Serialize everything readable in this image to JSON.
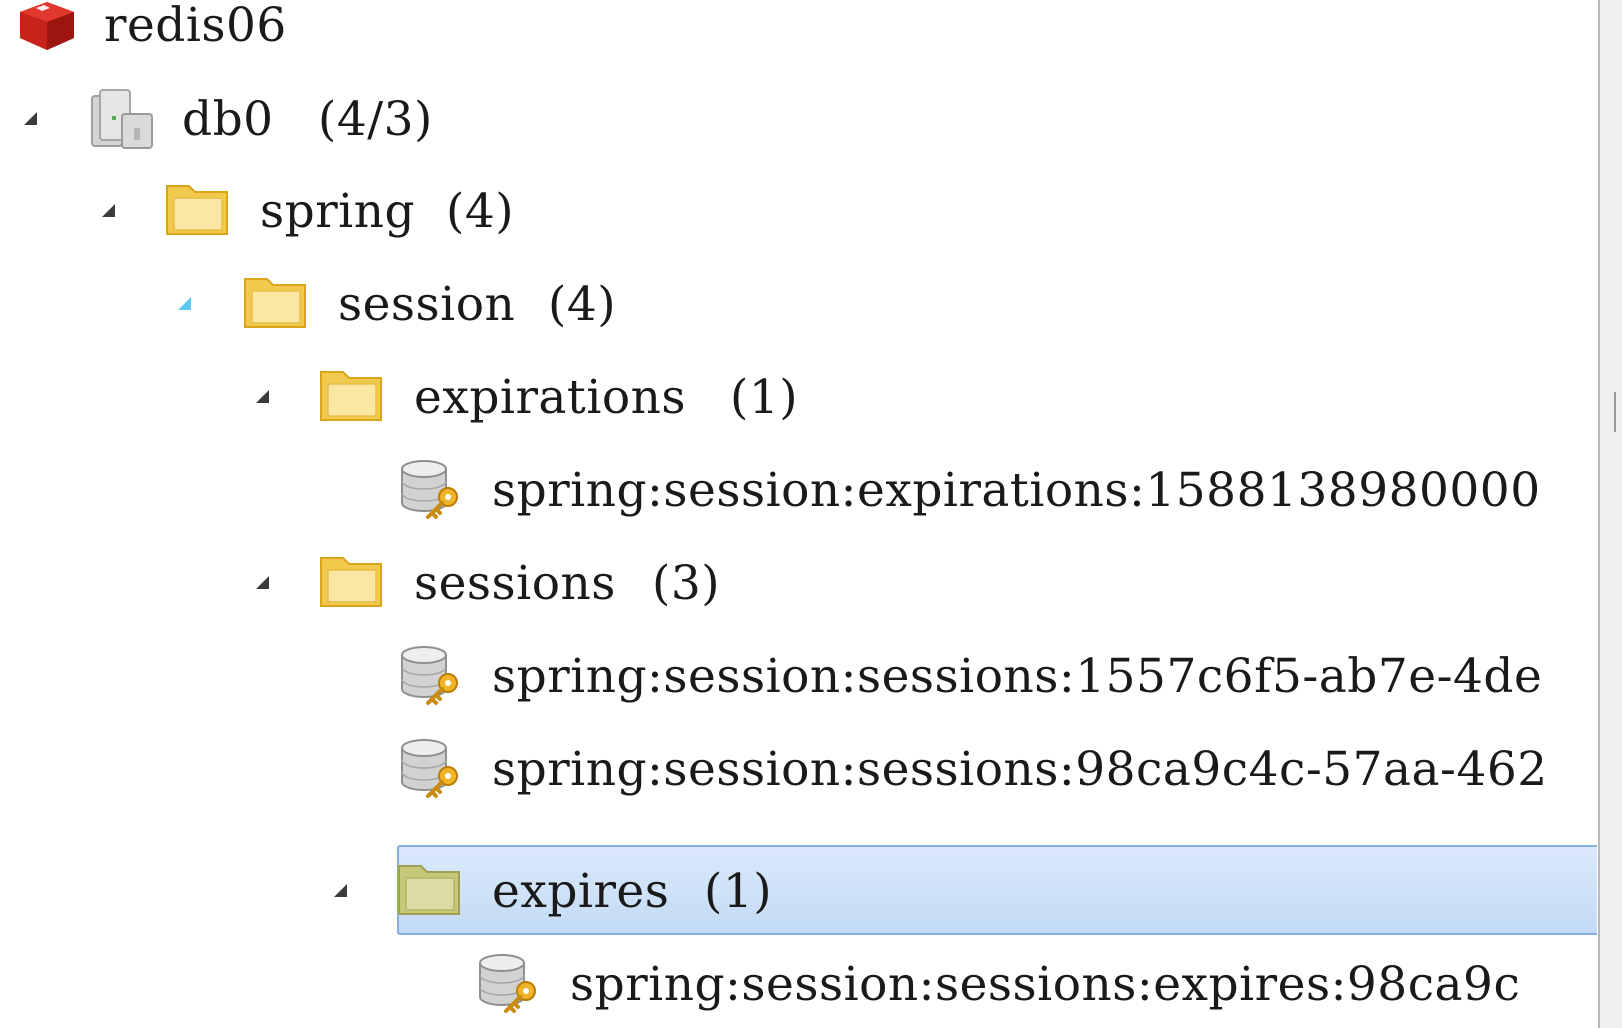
{
  "tree": {
    "connection": {
      "label": "redis06",
      "icon": "redis-cube-icon"
    },
    "database": {
      "label": "db0",
      "count": "(4/3)",
      "icon": "database-server-icon"
    },
    "folder_spring": {
      "label": "spring",
      "count": "(4)",
      "icon": "folder-icon"
    },
    "folder_session": {
      "label": "session",
      "count": "(4)",
      "icon": "folder-icon"
    },
    "folder_expirations": {
      "label": "expirations",
      "count": "(1)",
      "icon": "folder-icon"
    },
    "key_expirations": {
      "label": "spring:session:expirations:1588138980000",
      "icon": "key-db-icon"
    },
    "folder_sessions": {
      "label": "sessions",
      "count": "(3)",
      "icon": "folder-icon"
    },
    "key_session_1": {
      "label": "spring:session:sessions:1557c6f5-ab7e-4de",
      "icon": "key-db-icon"
    },
    "key_session_2": {
      "label": "spring:session:sessions:98ca9c4c-57aa-462",
      "icon": "key-db-icon"
    },
    "folder_expires": {
      "label": "expires",
      "count": "(1)",
      "icon": "folder-icon",
      "selected": true
    },
    "key_expires": {
      "label": "spring:session:sessions:expires:98ca9c",
      "icon": "key-db-icon"
    }
  },
  "colors": {
    "selection_bg": "#c3dbf6",
    "selection_border": "#87ade2",
    "folder": "#f2c94c",
    "redis_red": "#c8231b",
    "expand_active": "#5ec8f2"
  }
}
